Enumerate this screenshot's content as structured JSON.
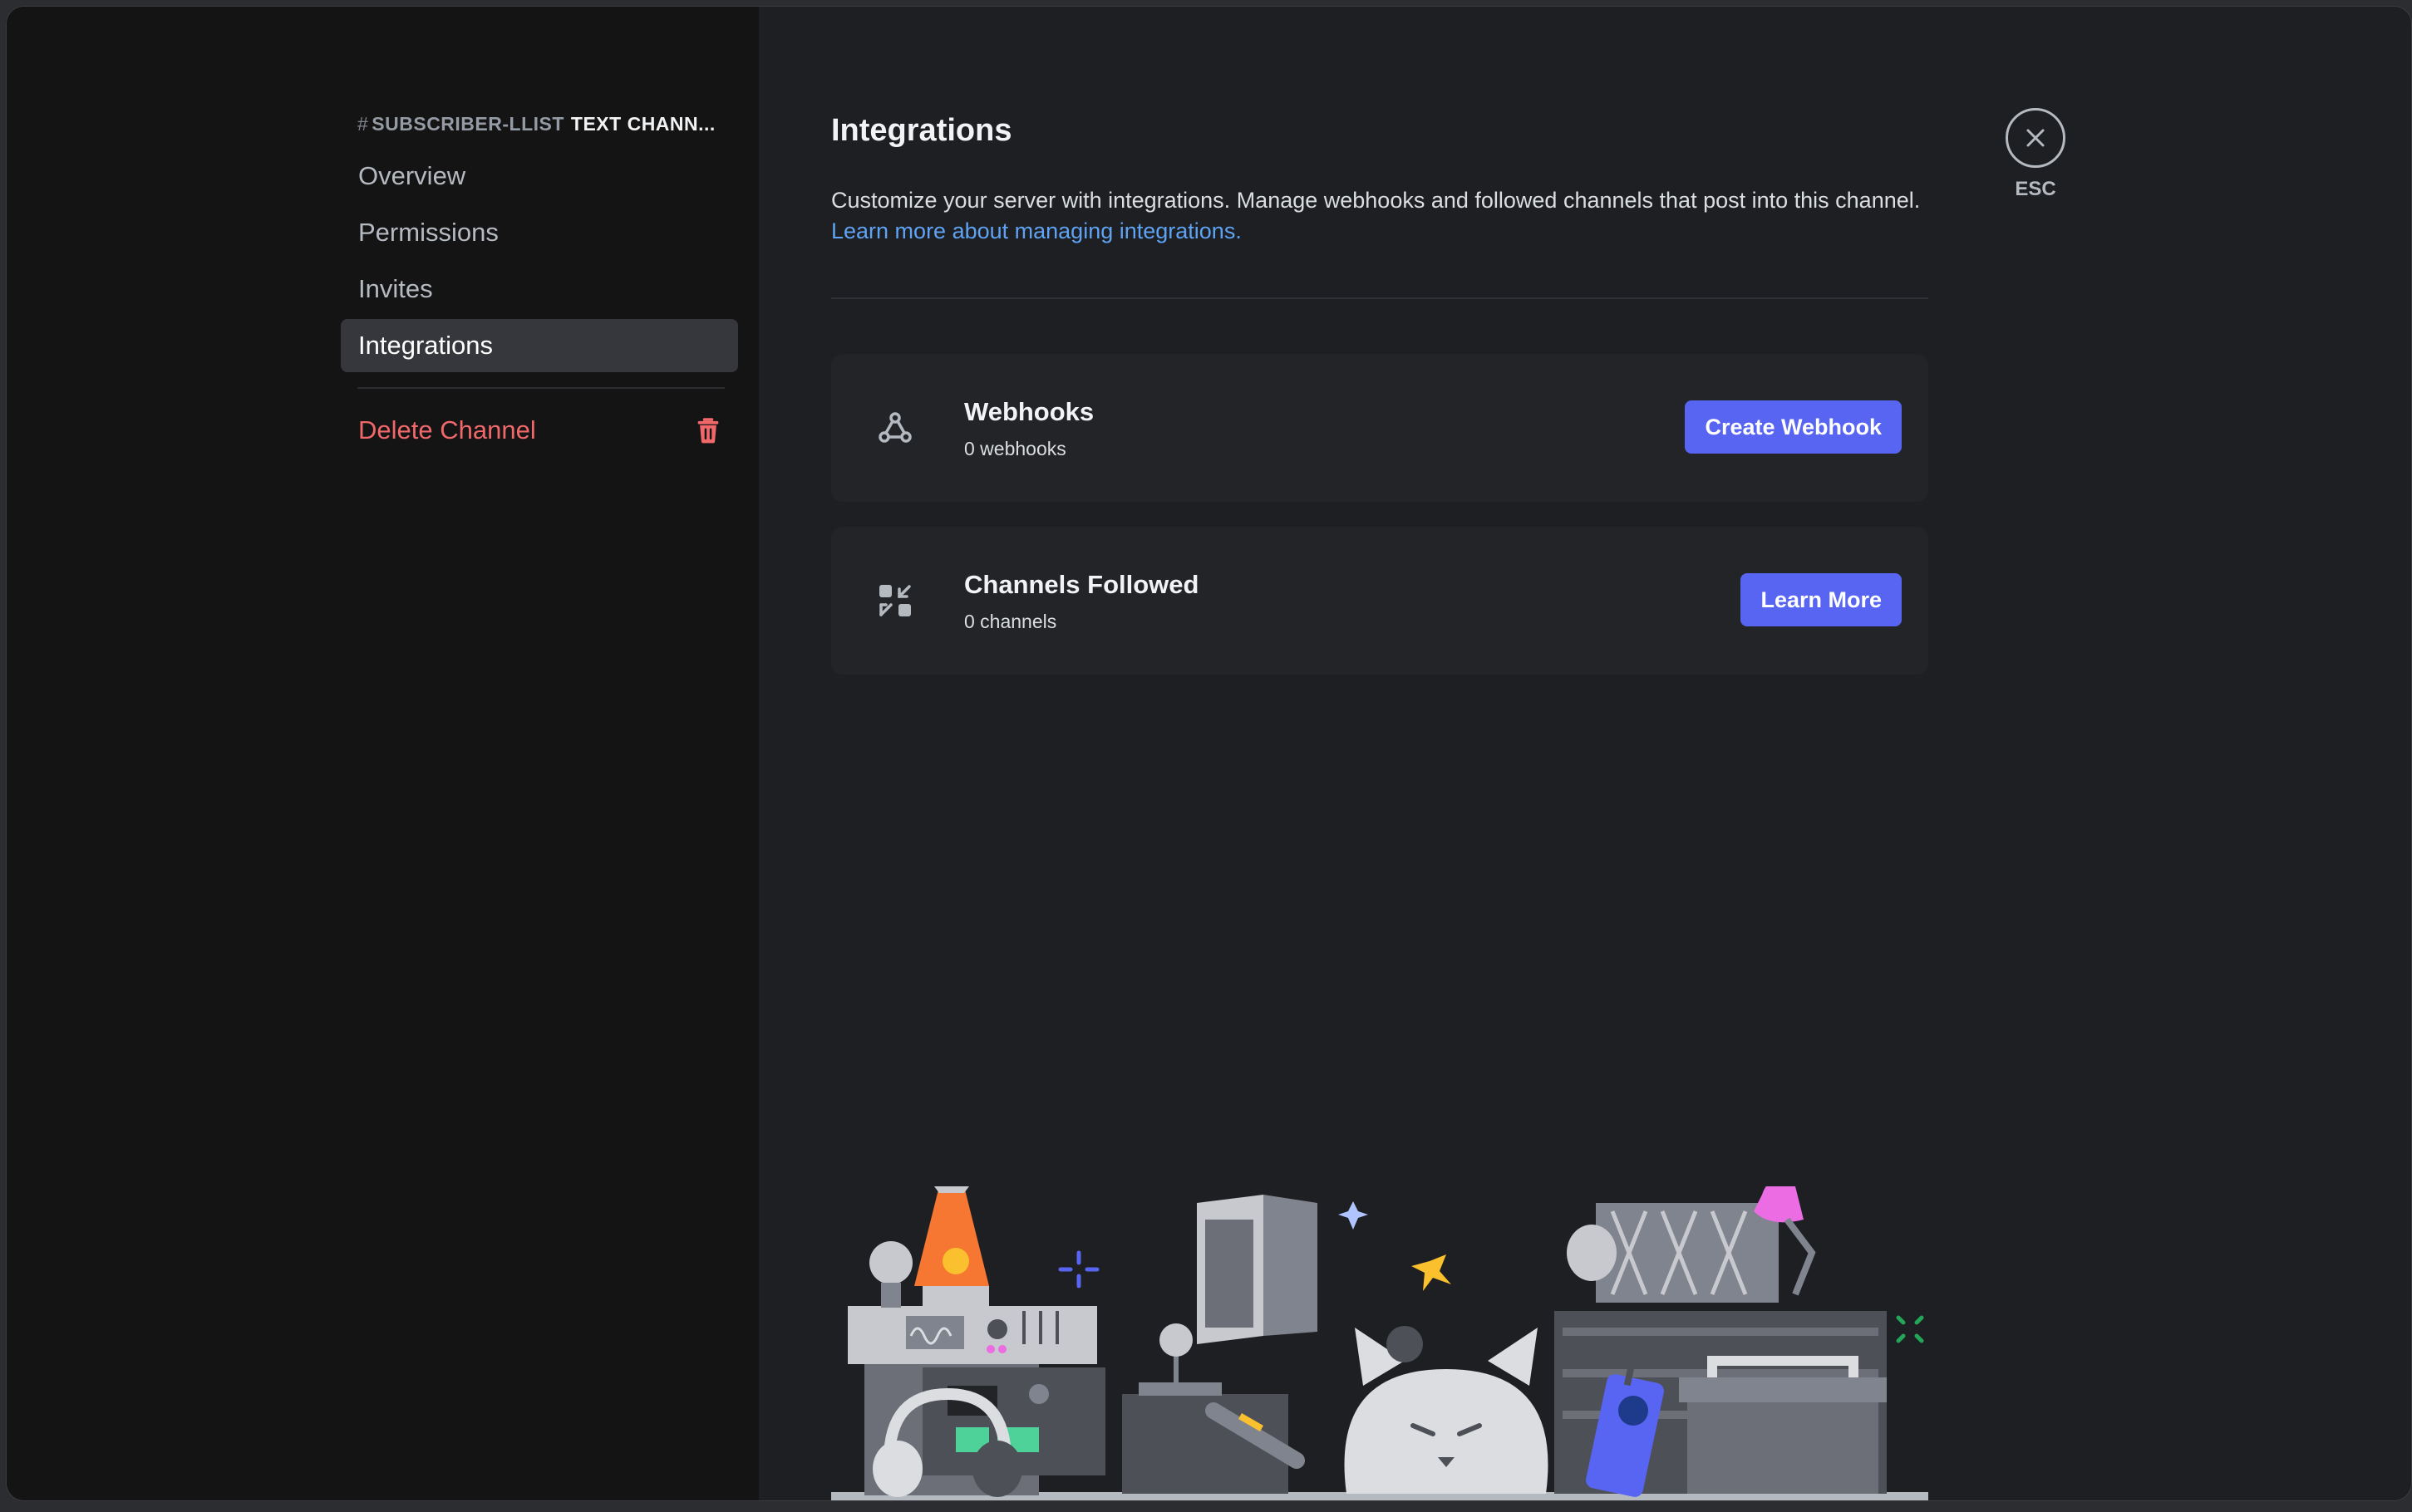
{
  "sidebar": {
    "header": {
      "hash": "#",
      "channel_name": "SUBSCRIBER-LLIST",
      "channel_type": "TEXT CHANN..."
    },
    "items": [
      {
        "label": "Overview",
        "active": false
      },
      {
        "label": "Permissions",
        "active": false
      },
      {
        "label": "Invites",
        "active": false
      },
      {
        "label": "Integrations",
        "active": true
      }
    ],
    "delete_label": "Delete Channel"
  },
  "main": {
    "title": "Integrations",
    "description": "Customize your server with integrations. Manage webhooks and followed channels that post into this channel.",
    "learn_link": "Learn more about managing integrations.",
    "cards": [
      {
        "icon": "webhook-icon",
        "title": "Webhooks",
        "subtitle": "0 webhooks",
        "button": "Create Webhook"
      },
      {
        "icon": "channels-followed-icon",
        "title": "Channels Followed",
        "subtitle": "0 channels",
        "button": "Learn More"
      }
    ]
  },
  "close": {
    "label": "ESC"
  },
  "colors": {
    "accent": "#5865f2",
    "danger": "#f0686a",
    "link": "#5ea3f4",
    "sidebar_bg": "#141415",
    "content_bg": "#1e1f22"
  }
}
